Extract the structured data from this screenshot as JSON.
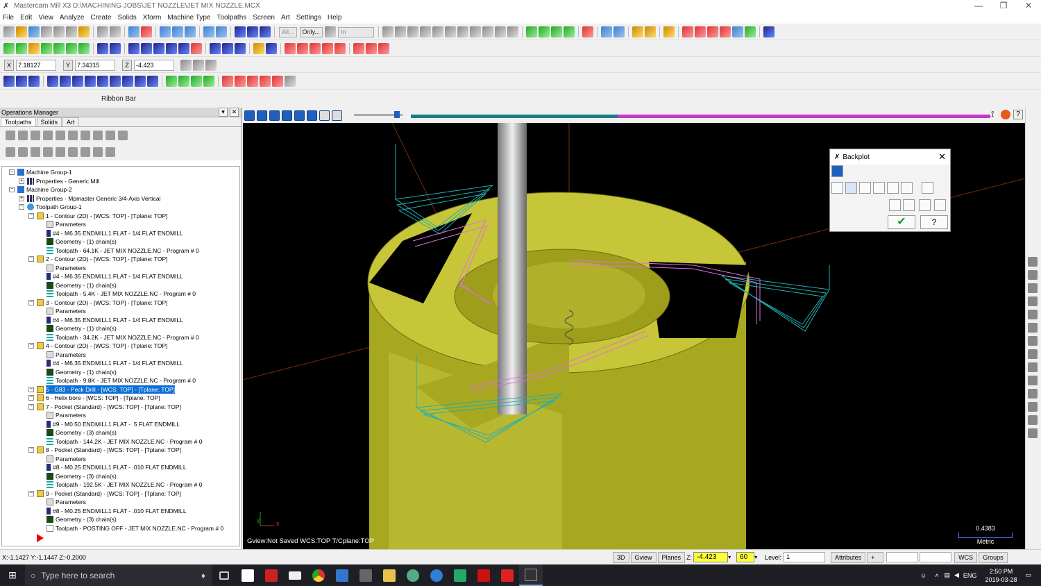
{
  "window": {
    "title": "Mastercam Mill X3  D:\\MACHINING JOBS\\JET NOZZLE\\JET MIX NOZZLE.MCX"
  },
  "menu": [
    "File",
    "Edit",
    "View",
    "Analyze",
    "Create",
    "Solids",
    "Xform",
    "Machine Type",
    "Toolpaths",
    "Screen",
    "Art",
    "Settings",
    "Help"
  ],
  "toolbar": {
    "all_label": "All...",
    "only_label": "Only...",
    "units_value": "In"
  },
  "coords": {
    "x_label": "X",
    "x": "7.18127",
    "y_label": "Y",
    "y": "7.34315",
    "z_label": "Z",
    "z": "-4.423"
  },
  "ribbon_label": "Ribbon Bar",
  "ops": {
    "title": "Operations Manager",
    "tabs": [
      "Toolpaths",
      "Solids",
      "Art"
    ],
    "tree": [
      {
        "label": "Machine Group-1",
        "icon": "grp"
      },
      {
        "label": "Properties - Generic Mill",
        "icon": "prop"
      },
      {
        "label": "Machine Group-2",
        "icon": "grp"
      },
      {
        "label": "Properties - Mpmaster Generic 3/4-Axis Vertical",
        "icon": "prop"
      },
      {
        "label": "Toolpath Group-1",
        "icon": "tpg"
      },
      {
        "label": "1 - Contour (2D) - [WCS: TOP] - [Tplane: TOP]",
        "icon": "fold"
      },
      {
        "label": "Parameters",
        "icon": "param"
      },
      {
        "label": "#4 - M6.35 ENDMILL1 FLAT -  1/4 FLAT ENDMILL",
        "icon": "tool"
      },
      {
        "label": "Geometry - (1) chain(s)",
        "icon": "geo"
      },
      {
        "label": "Toolpath - 64.1K - JET MIX NOZZLE.NC - Program # 0",
        "icon": "tpath"
      },
      {
        "label": "2 - Contour (2D) - [WCS: TOP] - [Tplane: TOP]",
        "icon": "fold"
      },
      {
        "label": "Parameters",
        "icon": "param"
      },
      {
        "label": "#4 - M6.35 ENDMILL1 FLAT -  1/4 FLAT ENDMILL",
        "icon": "tool"
      },
      {
        "label": "Geometry - (1) chain(s)",
        "icon": "geo"
      },
      {
        "label": "Toolpath - 5.4K - JET MIX NOZZLE.NC - Program # 0",
        "icon": "tpath"
      },
      {
        "label": "3 - Contour (2D) - [WCS: TOP] - [Tplane: TOP]",
        "icon": "fold"
      },
      {
        "label": "Parameters",
        "icon": "param"
      },
      {
        "label": "#4 - M6.35 ENDMILL1 FLAT -  1/4 FLAT ENDMILL",
        "icon": "tool"
      },
      {
        "label": "Geometry - (1) chain(s)",
        "icon": "geo"
      },
      {
        "label": "Toolpath - 34.2K - JET MIX NOZZLE.NC - Program # 0",
        "icon": "tpath"
      },
      {
        "label": "4 - Contour (2D) - [WCS: TOP] - [Tplane: TOP]",
        "icon": "fold"
      },
      {
        "label": "Parameters",
        "icon": "param"
      },
      {
        "label": "#4 - M6.35 ENDMILL1 FLAT -  1/4 FLAT ENDMILL",
        "icon": "tool"
      },
      {
        "label": "Geometry - (1) chain(s)",
        "icon": "geo"
      },
      {
        "label": "Toolpath - 9.8K - JET MIX NOZZLE.NC - Program # 0",
        "icon": "tpath"
      },
      {
        "label": "5 - G83 - Peck Drill - [WCS: TOP] - [Tplane: TOP]",
        "icon": "fold"
      },
      {
        "label": "6 - Helix bore - [WCS: TOP] - [Tplane: TOP]",
        "icon": "fold"
      },
      {
        "label": "7 - Pocket (Standard) - [WCS: TOP] - [Tplane: TOP]",
        "icon": "fold"
      },
      {
        "label": "Parameters",
        "icon": "param"
      },
      {
        "label": "#9 - M0.50 ENDMILL1 FLAT - .5 FLAT ENDMILL",
        "icon": "tool"
      },
      {
        "label": "Geometry - (3) chain(s)",
        "icon": "geo"
      },
      {
        "label": "Toolpath - 144.2K - JET MIX NOZZLE.NC - Program # 0",
        "icon": "tpath"
      },
      {
        "label": "8 - Pocket (Standard) - [WCS: TOP] - [Tplane: TOP]",
        "icon": "fold"
      },
      {
        "label": "Parameters",
        "icon": "param"
      },
      {
        "label": "#8 - M0.25 ENDMILL1 FLAT - .010 FLAT ENDMILL",
        "icon": "tool"
      },
      {
        "label": "Geometry - (3) chain(s)",
        "icon": "geo"
      },
      {
        "label": "Toolpath - 192.5K - JET MIX NOZZLE.NC - Program # 0",
        "icon": "tpath"
      },
      {
        "label": "9 - Pocket (Standard) - [WCS: TOP] - [Tplane: TOP]",
        "icon": "fold"
      },
      {
        "label": "Parameters",
        "icon": "param"
      },
      {
        "label": "#8 - M0.25 ENDMILL1 FLAT - .010 FLAT ENDMILL",
        "icon": "tool"
      },
      {
        "label": "Geometry - (3) chain(s)",
        "icon": "geo"
      },
      {
        "label": "Toolpath - POSTING OFF - JET MIX NOZZLE.NC - Program # 0",
        "icon": "post"
      }
    ],
    "selected_index": 25
  },
  "backplot": {
    "title": "Backplot"
  },
  "viewport": {
    "status": "Gview:Not Saved   WCS:TOP   T/Cplane:TOP",
    "scale_value": "0.4383",
    "scale_unit": "Metric"
  },
  "statusbar": {
    "cursor": "X:-1.1427  Y:-1.1447  Z:-0.2000",
    "view3d": "3D",
    "gview": "Gview",
    "planes": "Planes",
    "z_label": "Z:",
    "z_value": "-4.423",
    "color_value": "60",
    "level_label": "Level:",
    "level_value": "1",
    "attributes": "Attributes",
    "wcs": "WCS",
    "groups": "Groups"
  },
  "taskbar": {
    "search_placeholder": "Type here to search",
    "time": "2:50 PM",
    "date": "2019-03-28",
    "lang": "ENG"
  },
  "colors": {
    "stock": "#c8c840",
    "toolpath_cyan": "#1fb0b0",
    "toolpath_magenta": "#e070e0",
    "selection": "#0a6fd6"
  }
}
